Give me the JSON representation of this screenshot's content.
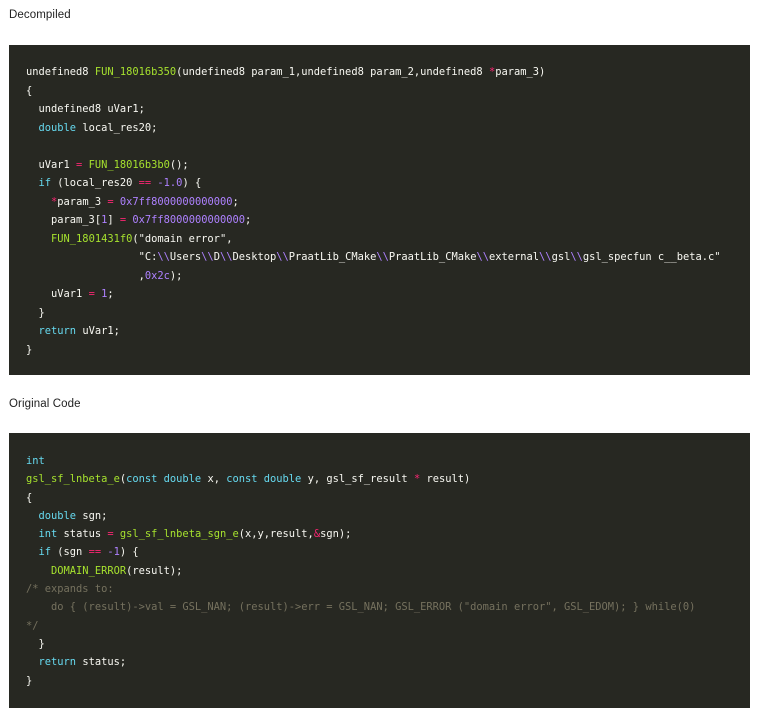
{
  "sections": {
    "decompiled_title": "Decompiled",
    "original_title": "Original Code"
  },
  "decompiled": {
    "lines": [
      [
        {
          "t": "undefined8 ",
          "c": "tx"
        },
        {
          "t": "FUN_18016b350",
          "c": "fn"
        },
        {
          "t": "(undefined8 param_1,undefined8 param_2,undefined8 ",
          "c": "tx"
        },
        {
          "t": "*",
          "c": "op"
        },
        {
          "t": "param_3)",
          "c": "tx"
        }
      ],
      [
        {
          "t": "{",
          "c": "tx"
        }
      ],
      [
        {
          "t": "  undefined8 uVar1;",
          "c": "tx"
        }
      ],
      [
        {
          "t": "  ",
          "c": "tx"
        },
        {
          "t": "double",
          "c": "kw"
        },
        {
          "t": " local_res20;",
          "c": "tx"
        }
      ],
      [
        {
          "t": "",
          "c": "tx"
        }
      ],
      [
        {
          "t": "  uVar1 ",
          "c": "tx"
        },
        {
          "t": "=",
          "c": "op"
        },
        {
          "t": " ",
          "c": "tx"
        },
        {
          "t": "FUN_18016b3b0",
          "c": "fn"
        },
        {
          "t": "();",
          "c": "tx"
        }
      ],
      [
        {
          "t": "  ",
          "c": "tx"
        },
        {
          "t": "if",
          "c": "kw"
        },
        {
          "t": " (local_res20 ",
          "c": "tx"
        },
        {
          "t": "==",
          "c": "op"
        },
        {
          "t": " ",
          "c": "tx"
        },
        {
          "t": "-1.0",
          "c": "num"
        },
        {
          "t": ") {",
          "c": "tx"
        }
      ],
      [
        {
          "t": "    ",
          "c": "tx"
        },
        {
          "t": "*",
          "c": "op"
        },
        {
          "t": "param_3 ",
          "c": "tx"
        },
        {
          "t": "=",
          "c": "op"
        },
        {
          "t": " ",
          "c": "tx"
        },
        {
          "t": "0x7ff8000000000000",
          "c": "num"
        },
        {
          "t": ";",
          "c": "tx"
        }
      ],
      [
        {
          "t": "    param_3[",
          "c": "tx"
        },
        {
          "t": "1",
          "c": "num"
        },
        {
          "t": "] ",
          "c": "tx"
        },
        {
          "t": "=",
          "c": "op"
        },
        {
          "t": " ",
          "c": "tx"
        },
        {
          "t": "0x7ff8000000000000",
          "c": "num"
        },
        {
          "t": ";",
          "c": "tx"
        }
      ],
      [
        {
          "t": "    ",
          "c": "tx"
        },
        {
          "t": "FUN_1801431f0",
          "c": "fn"
        },
        {
          "t": "(\"domain error\",",
          "c": "tx"
        }
      ],
      [
        {
          "t": "                  \"C:",
          "c": "tx"
        },
        {
          "t": "\\\\",
          "c": "esc"
        },
        {
          "t": "Users",
          "c": "tx"
        },
        {
          "t": "\\\\",
          "c": "esc"
        },
        {
          "t": "D",
          "c": "tx"
        },
        {
          "t": "\\\\",
          "c": "esc"
        },
        {
          "t": "Desktop",
          "c": "tx"
        },
        {
          "t": "\\\\",
          "c": "esc"
        },
        {
          "t": "PraatLib_CMake",
          "c": "tx"
        },
        {
          "t": "\\\\",
          "c": "esc"
        },
        {
          "t": "PraatLib_CMake",
          "c": "tx"
        },
        {
          "t": "\\\\",
          "c": "esc"
        },
        {
          "t": "external",
          "c": "tx"
        },
        {
          "t": "\\\\",
          "c": "esc"
        },
        {
          "t": "gsl",
          "c": "tx"
        },
        {
          "t": "\\\\",
          "c": "esc"
        },
        {
          "t": "gsl_specfun c__beta.c\"",
          "c": "tx"
        }
      ],
      [
        {
          "t": "                  ,",
          "c": "tx"
        },
        {
          "t": "0x2c",
          "c": "num"
        },
        {
          "t": ");",
          "c": "tx"
        }
      ],
      [
        {
          "t": "    uVar1 ",
          "c": "tx"
        },
        {
          "t": "=",
          "c": "op"
        },
        {
          "t": " ",
          "c": "tx"
        },
        {
          "t": "1",
          "c": "num"
        },
        {
          "t": ";",
          "c": "tx"
        }
      ],
      [
        {
          "t": "  }",
          "c": "tx"
        }
      ],
      [
        {
          "t": "  ",
          "c": "tx"
        },
        {
          "t": "return",
          "c": "kw"
        },
        {
          "t": " uVar1;",
          "c": "tx"
        }
      ],
      [
        {
          "t": "}",
          "c": "tx"
        }
      ]
    ]
  },
  "original": {
    "lines": [
      [
        {
          "t": "int",
          "c": "kw"
        }
      ],
      [
        {
          "t": "gsl_sf_lnbeta_e",
          "c": "fn"
        },
        {
          "t": "(",
          "c": "tx"
        },
        {
          "t": "const",
          "c": "kw"
        },
        {
          "t": " ",
          "c": "tx"
        },
        {
          "t": "double",
          "c": "kw"
        },
        {
          "t": " x, ",
          "c": "tx"
        },
        {
          "t": "const",
          "c": "kw"
        },
        {
          "t": " ",
          "c": "tx"
        },
        {
          "t": "double",
          "c": "kw"
        },
        {
          "t": " y, gsl_sf_result ",
          "c": "tx"
        },
        {
          "t": "*",
          "c": "op"
        },
        {
          "t": " result)",
          "c": "tx"
        }
      ],
      [
        {
          "t": "{",
          "c": "tx"
        }
      ],
      [
        {
          "t": "  ",
          "c": "tx"
        },
        {
          "t": "double",
          "c": "kw"
        },
        {
          "t": " sgn;",
          "c": "tx"
        }
      ],
      [
        {
          "t": "  ",
          "c": "tx"
        },
        {
          "t": "int",
          "c": "kw"
        },
        {
          "t": " status ",
          "c": "tx"
        },
        {
          "t": "=",
          "c": "op"
        },
        {
          "t": " ",
          "c": "tx"
        },
        {
          "t": "gsl_sf_lnbeta_sgn_e",
          "c": "fn"
        },
        {
          "t": "(x,y,result,",
          "c": "tx"
        },
        {
          "t": "&",
          "c": "op"
        },
        {
          "t": "sgn);",
          "c": "tx"
        }
      ],
      [
        {
          "t": "  ",
          "c": "tx"
        },
        {
          "t": "if",
          "c": "kw"
        },
        {
          "t": " (sgn ",
          "c": "tx"
        },
        {
          "t": "==",
          "c": "op"
        },
        {
          "t": " ",
          "c": "tx"
        },
        {
          "t": "-1",
          "c": "num"
        },
        {
          "t": ") {",
          "c": "tx"
        }
      ],
      [
        {
          "t": "    ",
          "c": "tx"
        },
        {
          "t": "DOMAIN_ERROR",
          "c": "fn"
        },
        {
          "t": "(result);",
          "c": "tx"
        }
      ],
      [
        {
          "t": "/* expands to:",
          "c": "cm"
        }
      ],
      [
        {
          "t": "    do { (result)->val = GSL_NAN; (result)->err = GSL_NAN; GSL_ERROR (\"domain error\", GSL_EDOM); } while(0)",
          "c": "cm"
        }
      ],
      [
        {
          "t": "*/",
          "c": "cm"
        }
      ],
      [
        {
          "t": "  }",
          "c": "tx"
        }
      ],
      [
        {
          "t": "  ",
          "c": "tx"
        },
        {
          "t": "return",
          "c": "kw"
        },
        {
          "t": " status;",
          "c": "tx"
        }
      ],
      [
        {
          "t": "}",
          "c": "tx"
        }
      ]
    ]
  }
}
